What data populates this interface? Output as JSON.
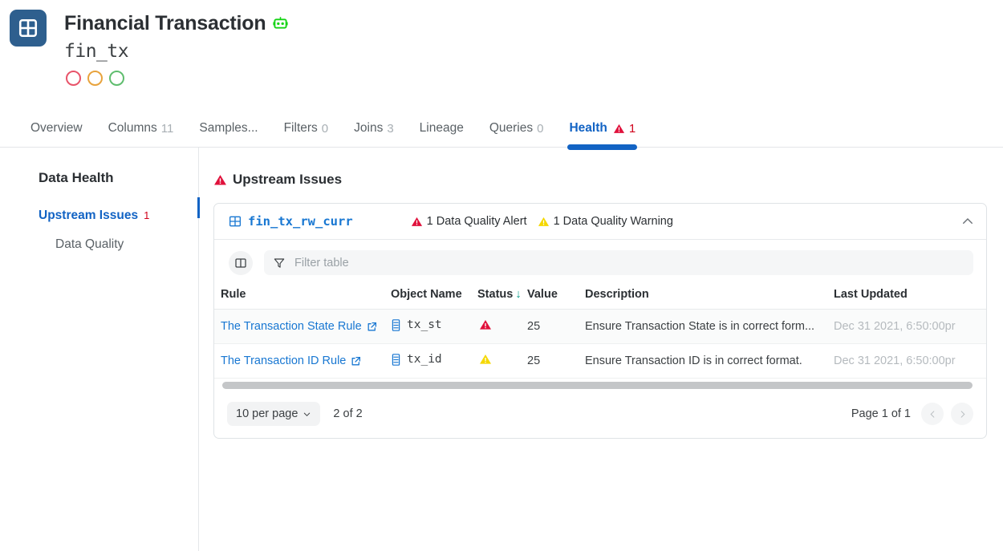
{
  "header": {
    "app_icon": "table-grid-icon",
    "title": "Financial Transaction",
    "robot_icon": "robot-icon",
    "code_name": "fin_tx",
    "status_dots": [
      {
        "name": "red-status-dot",
        "color": "#e8546a"
      },
      {
        "name": "orange-status-dot",
        "color": "#e8a33d"
      },
      {
        "name": "green-status-dot",
        "color": "#5fbd6e"
      }
    ]
  },
  "tabs": [
    {
      "label": "Overview",
      "count": "",
      "active": false
    },
    {
      "label": "Columns",
      "count": "11",
      "active": false
    },
    {
      "label": "Samples...",
      "count": "",
      "active": false
    },
    {
      "label": "Filters",
      "count": "0",
      "active": false
    },
    {
      "label": "Joins",
      "count": "3",
      "active": false
    },
    {
      "label": "Lineage",
      "count": "",
      "active": false
    },
    {
      "label": "Queries",
      "count": "0",
      "active": false
    },
    {
      "label": "Health",
      "count": "1",
      "active": true,
      "warn_icon": "warning-triangle-icon"
    }
  ],
  "sidebar": {
    "title": "Data Health",
    "items": [
      {
        "label": "Upstream Issues",
        "count": "1",
        "active": true
      },
      {
        "label": "Data Quality",
        "count": "",
        "active": false
      }
    ]
  },
  "content": {
    "heading": "Upstream Issues",
    "heading_icon": "alert-triangle-icon"
  },
  "card": {
    "table_icon": "table-grid-icon",
    "title": "fin_tx_rw_curr",
    "badges": [
      {
        "icon": "alert-triangle-icon",
        "label": "1 Data Quality Alert",
        "color": "#e0113b"
      },
      {
        "icon": "warning-triangle-icon",
        "label": "1 Data Quality Warning",
        "color": "#f5d800"
      }
    ],
    "collapse_icon": "chevron-up-icon"
  },
  "toolbar": {
    "columns_icon": "columns-layout-icon",
    "filter_icon": "funnel-icon",
    "filter_value": "",
    "filter_placeholder": "Filter table"
  },
  "table": {
    "columns": [
      "Rule",
      "Object Name",
      "Status",
      "Value",
      "Description",
      "Last Updated"
    ],
    "sorted_column": "Status",
    "sort_direction": "desc",
    "rows": [
      {
        "rule": "The Transaction State Rule",
        "rule_link_icon": "external-link-icon",
        "object_icon": "column-icon",
        "object_name": "tx_st",
        "status_icon": "alert-triangle-icon",
        "status_color": "#e0113b",
        "value": "25",
        "description": "Ensure Transaction State is in correct form...",
        "last_updated": "Dec 31 2021, 6:50:00pr"
      },
      {
        "rule": "The Transaction ID Rule",
        "rule_link_icon": "external-link-icon",
        "object_icon": "column-icon",
        "object_name": "tx_id",
        "status_icon": "warning-triangle-icon",
        "status_color": "#f5d800",
        "value": "25",
        "description": "Ensure Transaction ID is in correct format.",
        "last_updated": "Dec 31 2021, 6:50:00pr"
      }
    ]
  },
  "footer": {
    "per_page": "10 per page",
    "per_page_icon": "chevron-down-icon",
    "result_count": "2 of 2",
    "page_label": "Page 1 of 1",
    "prev_icon": "chevron-left-icon",
    "next_icon": "chevron-right-icon"
  }
}
